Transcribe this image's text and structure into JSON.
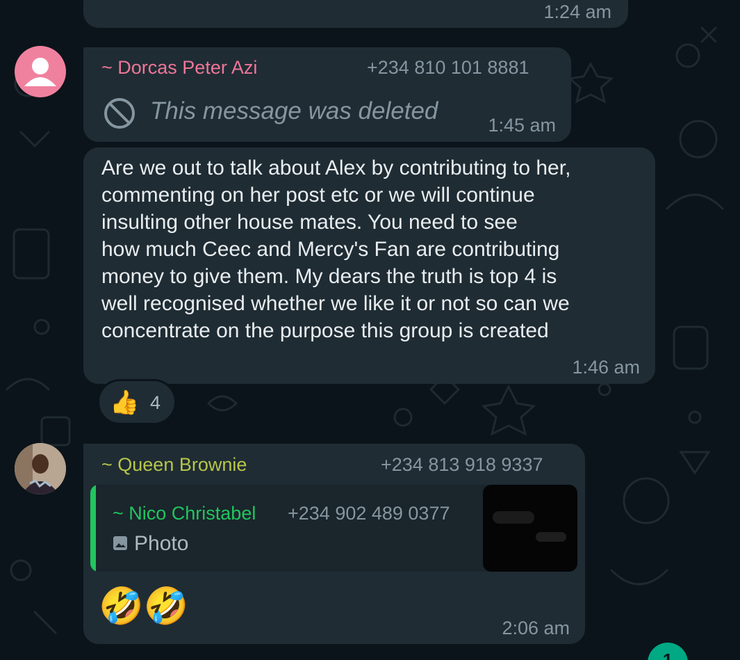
{
  "colors": {
    "background": "#0b141a",
    "bubble": "#1f2c34",
    "text": "#e9edef",
    "meta": "#8696a0",
    "dorcas_name": "#ef7697",
    "queen_name": "#b7c54a",
    "nico_name": "#22c55e",
    "accent": "#00a884"
  },
  "messages": {
    "top": {
      "time": "1:24 am"
    },
    "dorcas": {
      "name": "~ Dorcas Peter Azi",
      "phone": "+234 810 101 8881",
      "deleted_text": "This message was deleted",
      "time": "1:45 am",
      "avatar_icon": "default-person-icon"
    },
    "long": {
      "text": "Are we out to talk about Alex by contributing to her,\ncommenting on her post etc or we will continue\ninsulting other house mates. You need to see\nhow much Ceec and Mercy's Fan are contributing\nmoney to give them. My dears the truth is top 4 is\nwell recognised whether we like it or not so can we\nconcentrate on the purpose this group is created",
      "time": "1:46 am",
      "reaction": {
        "emoji": "👍",
        "count": "4"
      }
    },
    "queen": {
      "name": "~ Queen Brownie",
      "phone": "+234 813 918 9337",
      "quote": {
        "name": "~ Nico Christabel",
        "phone": "+234 902 489 0377",
        "media_label": "Photo",
        "media_icon": "image-icon"
      },
      "emojis": "🤣🤣",
      "time": "2:06 am"
    }
  },
  "fab": {
    "label": "1"
  }
}
